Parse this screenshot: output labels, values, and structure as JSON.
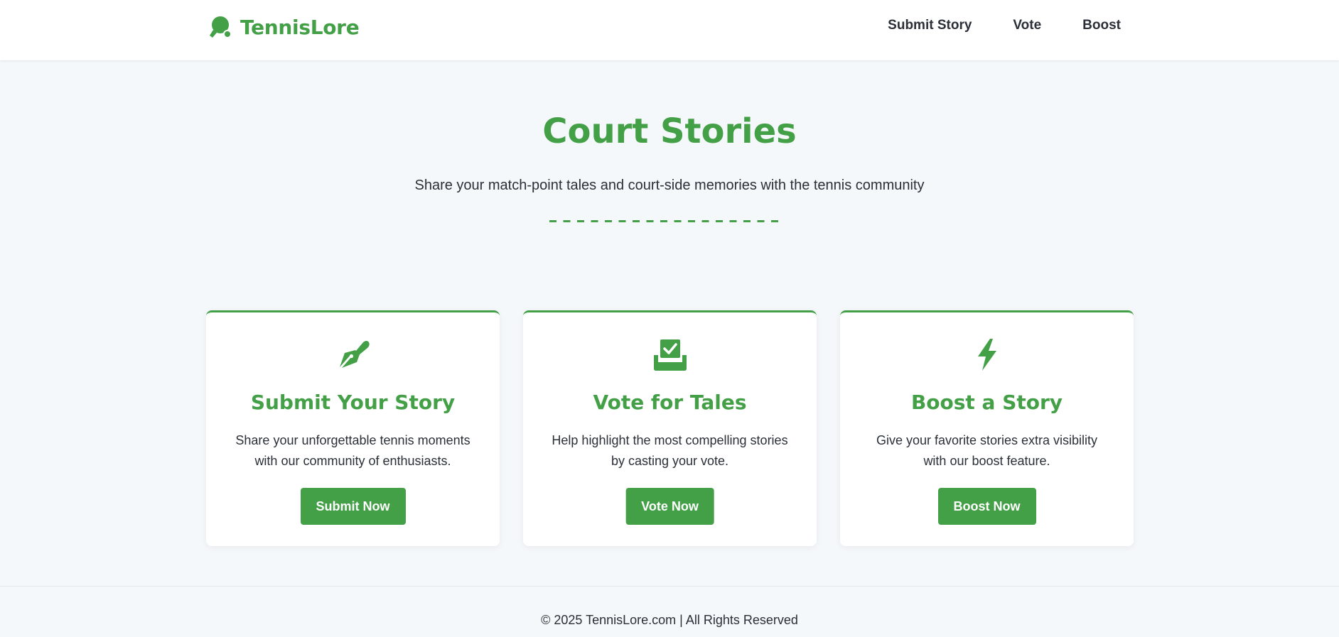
{
  "brand": {
    "name": "TennisLore",
    "logo_icon": "ping-pong-paddle-icon",
    "color": "#43a047"
  },
  "nav": {
    "items": [
      {
        "label": "Submit Story"
      },
      {
        "label": "Vote"
      },
      {
        "label": "Boost"
      }
    ]
  },
  "hero": {
    "title": "Court Stories",
    "subtitle": "Share your match-point tales and court-side memories with the tennis community"
  },
  "cards": [
    {
      "icon": "pen-nib-icon",
      "title": "Submit Your Story",
      "description": "Share your unforgettable tennis moments with our community of enthusiasts.",
      "button": "Submit Now"
    },
    {
      "icon": "vote-box-check-icon",
      "title": "Vote for Tales",
      "description": "Help highlight the most compelling stories by casting your vote.",
      "button": "Vote Now"
    },
    {
      "icon": "lightning-bolt-icon",
      "title": "Boost a Story",
      "description": "Give your favorite stories extra visibility with our boost feature.",
      "button": "Boost Now"
    }
  ],
  "footer": {
    "text": "© 2025 TennisLore.com | All Rights Reserved"
  },
  "colors": {
    "accent": "#43a047",
    "background": "#f5f8fa",
    "text": "#2b2f38"
  }
}
